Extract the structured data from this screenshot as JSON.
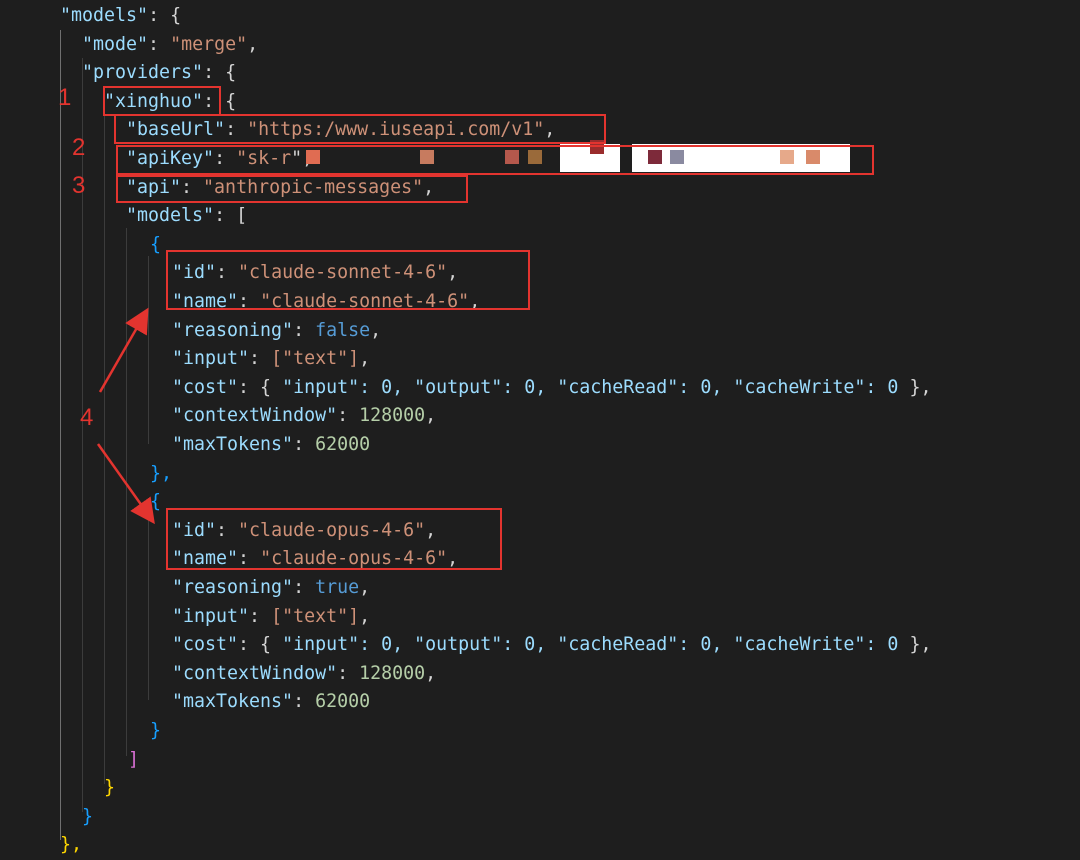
{
  "code_lines": [
    {
      "k": "\"models\"",
      "rest": ": {"
    },
    {
      "k": "\"mode\"",
      "rest": ": ",
      "s": "\"merge\"",
      "tail": ","
    },
    {
      "k": "\"providers\"",
      "rest": ": {"
    },
    {
      "k": "\"xinghuo\"",
      "rest": ": {"
    },
    {
      "k": "\"baseUrl\"",
      "rest": ": ",
      "s": "\"https:/www.iuseapi.com/v1\"",
      "tail": ","
    },
    {
      "k": "\"apiKey\"",
      "rest": ": ",
      "s": "\"sk-r",
      "tail": "\","
    },
    {
      "k": "\"api\"",
      "rest": ": ",
      "s": "\"anthropic-messages\"",
      "tail": ","
    },
    {
      "k": "\"models\"",
      "rest": ": ["
    },
    {
      "brace": "{"
    },
    {
      "k": "\"id\"",
      "rest": ": ",
      "s": "\"claude-sonnet-4-6\"",
      "tail": ","
    },
    {
      "k": "\"name\"",
      "rest": ": ",
      "s": "\"claude-sonnet-4-6\"",
      "tail": ","
    },
    {
      "k": "\"reasoning\"",
      "rest": ": ",
      "b": "false",
      "tail": ","
    },
    {
      "k": "\"input\"",
      "rest": ": ",
      "arr": "[\"text\"]",
      "tail": ","
    },
    {
      "k": "\"cost\"",
      "rest": ": { ",
      "obj": "\"input\": 0, \"output\": 0, \"cacheRead\": 0, \"cacheWrite\": 0",
      "tail": " },"
    },
    {
      "k": "\"contextWindow\"",
      "rest": ": ",
      "n": "128000",
      "tail": ","
    },
    {
      "k": "\"maxTokens\"",
      "rest": ": ",
      "n": "62000"
    },
    {
      "brace": "},"
    },
    {
      "brace": "{"
    },
    {
      "k": "\"id\"",
      "rest": ": ",
      "s": "\"claude-opus-4-6\"",
      "tail": ","
    },
    {
      "k": "\"name\"",
      "rest": ": ",
      "s": "\"claude-opus-4-6\"",
      "tail": ","
    },
    {
      "k": "\"reasoning\"",
      "rest": ": ",
      "b": "true",
      "tail": ","
    },
    {
      "k": "\"input\"",
      "rest": ": ",
      "arr": "[\"text\"]",
      "tail": ","
    },
    {
      "k": "\"cost\"",
      "rest": ": { ",
      "obj": "\"input\": 0, \"output\": 0, \"cacheRead\": 0, \"cacheWrite\": 0",
      "tail": " },"
    },
    {
      "k": "\"contextWindow\"",
      "rest": ": ",
      "n": "128000",
      "tail": ","
    },
    {
      "k": "\"maxTokens\"",
      "rest": ": ",
      "n": "62000"
    },
    {
      "brace": "}"
    },
    {
      "brace": "]"
    },
    {
      "brace": "}"
    },
    {
      "brace": "}"
    },
    {
      "brace": "},"
    }
  ],
  "annotations": {
    "label_1": "1",
    "label_2": "2",
    "label_3": "3",
    "label_4": "4"
  },
  "colors": {
    "annotation_red": "#e3342f",
    "key_blue": "#9cdcfe",
    "string_orange": "#ce9178",
    "number_green": "#b5cea8",
    "bool_blue": "#569cd6"
  }
}
